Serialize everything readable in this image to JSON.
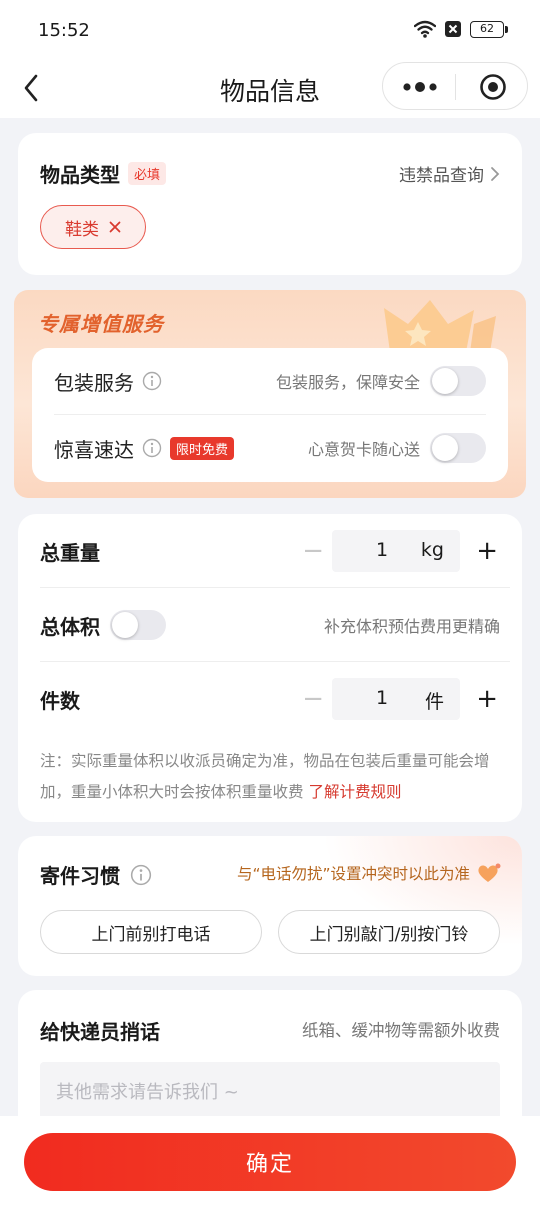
{
  "status_bar": {
    "time": "15:52",
    "battery": "62"
  },
  "nav": {
    "title": "物品信息"
  },
  "item_type": {
    "title": "物品类型",
    "required_tag": "必填",
    "link": "违禁品查询",
    "selected_chip": "鞋类"
  },
  "value_added": {
    "title": "专属增值服务",
    "rows": [
      {
        "label": "包装服务",
        "hint": "包装服务，保障安全",
        "enabled": false
      },
      {
        "label": "惊喜速达",
        "tag": "限时免费",
        "hint": "心意贺卡随心送",
        "enabled": false
      }
    ]
  },
  "weight": {
    "total_weight_label": "总重量",
    "weight_value": "1",
    "weight_unit": "kg",
    "volume_label": "总体积",
    "volume_hint": "补充体积预估费用更精确",
    "volume_enabled": false,
    "count_label": "件数",
    "count_value": "1",
    "count_unit": "件",
    "minus_symbol": "−",
    "plus_symbol": "+",
    "note": "注：实际重量体积以收派员确定为准，物品在包装后重量可能会增加，重量小体积大时会按体积重量收费",
    "note_link": "了解计费规则"
  },
  "habit": {
    "title": "寄件习惯",
    "hint": "与“电话勿扰”设置冲突时以此为准",
    "options": [
      "上门前别打电话",
      "上门别敲门/别按门铃"
    ]
  },
  "message": {
    "title": "给快递员捎话",
    "hint": "纸箱、缓冲物等需额外收费",
    "placeholder": "其他需求请告诉我们 ~"
  },
  "confirm": {
    "label": "确定"
  },
  "colors": {
    "accent": "#E8392C",
    "vas_title": "#E2622D",
    "habit_hint": "#B5651D"
  }
}
